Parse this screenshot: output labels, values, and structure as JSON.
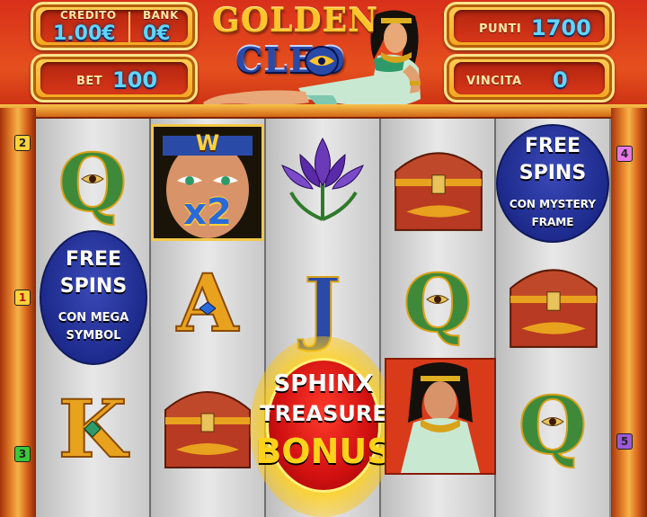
{
  "header": {
    "credito_label": "CREDITO",
    "credito_value": "1.00€",
    "bank_label": "BANK",
    "bank_value": "0€",
    "bet_label": "BET",
    "bet_value": "100",
    "punti_label": "PUNTI",
    "punti_value": "1700",
    "vincita_label": "VINCITA",
    "vincita_value": "0"
  },
  "logo": {
    "line1": "GOLDEN",
    "line2": "CLEO"
  },
  "paylines": {
    "left": [
      "2",
      "1",
      "3"
    ],
    "right": [
      "4",
      "5"
    ]
  },
  "symbols": {
    "q": "Q",
    "a": "A",
    "j": "J",
    "k": "K",
    "wild_w": "W",
    "wild_mult": "x2",
    "fs_mystery": {
      "l1": "FREE",
      "l2": "SPINS",
      "l3": "CON MYSTERY",
      "l4": "FRAME"
    },
    "fs_mega": {
      "l1": "FREE",
      "l2": "SPINS",
      "l3": "CON MEGA",
      "l4": "SYMBOL"
    },
    "bonus": {
      "l1": "SPHINX",
      "l2": "TREASURE",
      "l3": "BONUS"
    }
  },
  "colors": {
    "accent_gold": "#ffc52a",
    "value_cyan": "#5fd6ff",
    "card_green": "#3e8a3a",
    "card_gold": "#e8a21e"
  }
}
